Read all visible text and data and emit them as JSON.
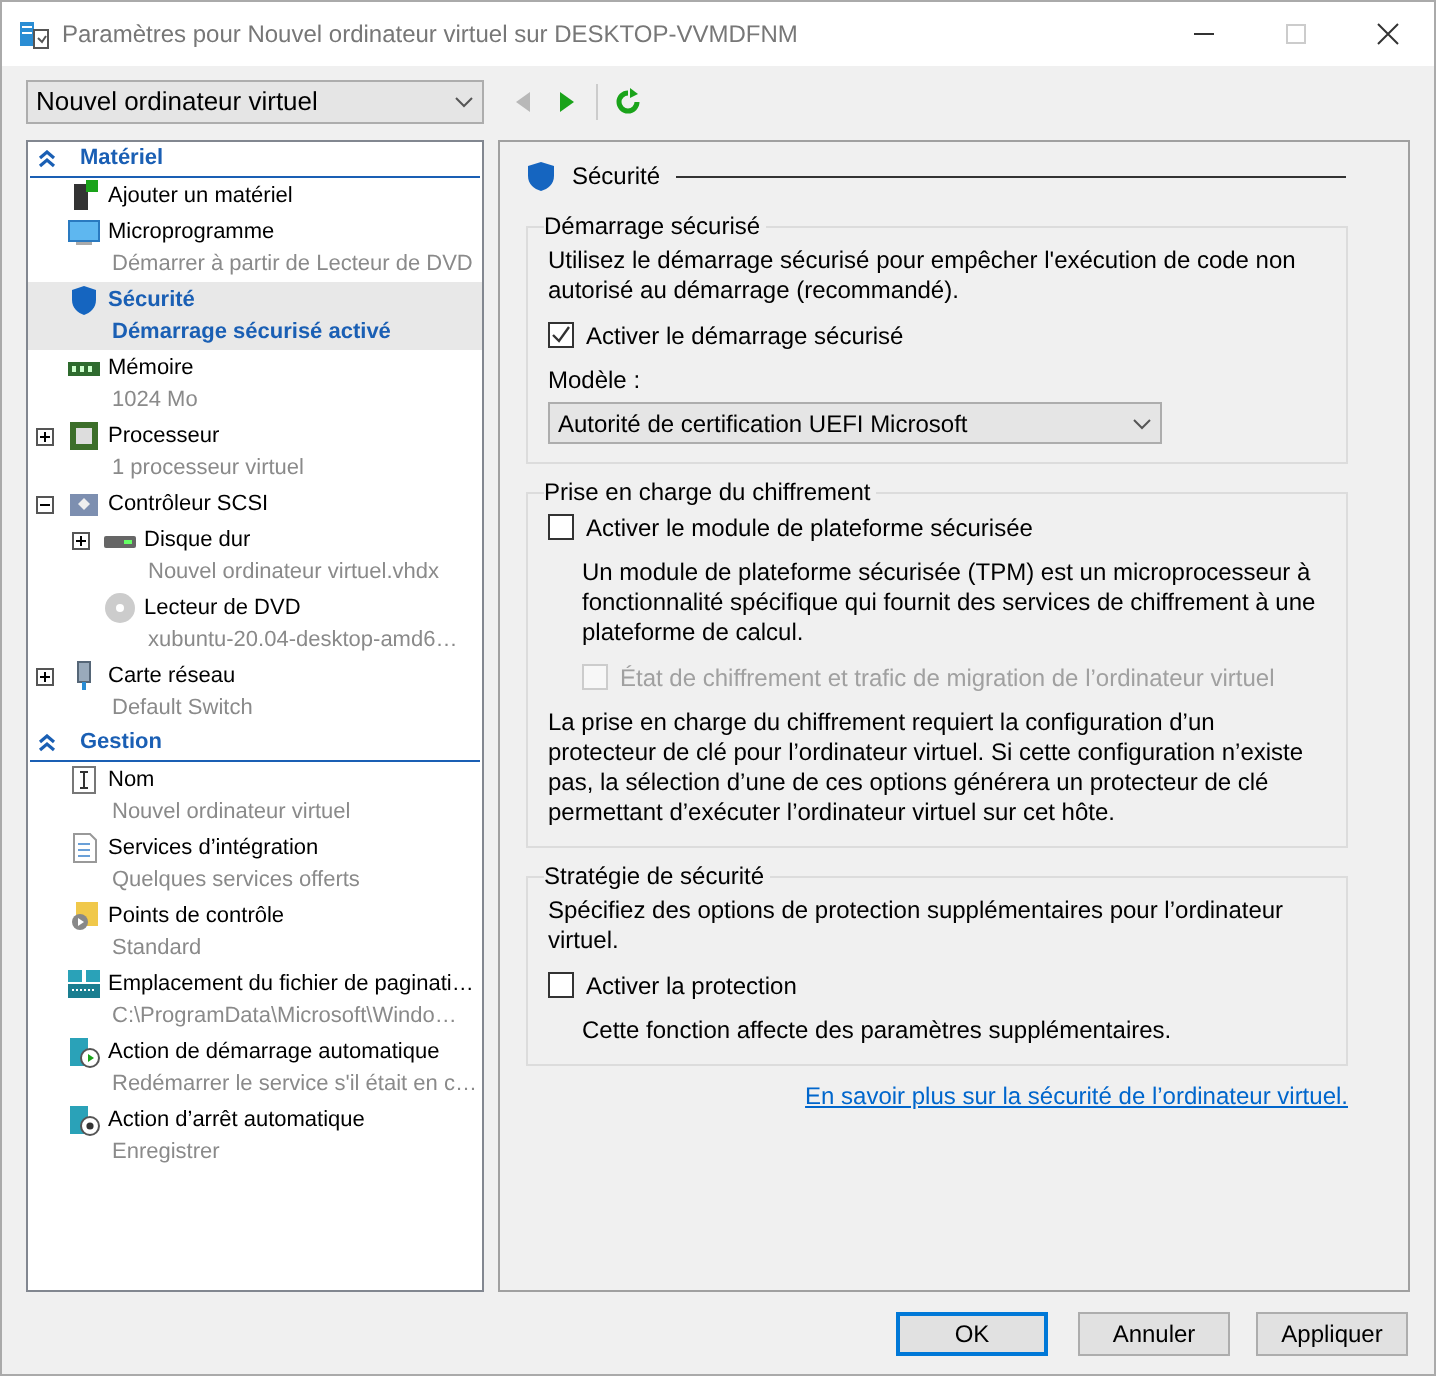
{
  "window": {
    "title": "Paramètres pour Nouvel ordinateur virtuel sur DESKTOP-VVMDFNM"
  },
  "toolbar": {
    "vm_select": "Nouvel ordinateur virtuel",
    "nav_buttons": [
      {
        "kind": "back",
        "disabled": true
      },
      {
        "kind": "forward",
        "disabled": false
      },
      {
        "kind": "refresh",
        "disabled": false
      }
    ]
  },
  "sidebar": {
    "sections": [
      {
        "title": "Matériel",
        "expanded": true,
        "items": [
          {
            "name": "Ajouter un matériel",
            "kind": "add-hardware",
            "selected": false
          },
          {
            "name": "Microprogramme",
            "detail": "Démarrer à partir de Lecteur de DVD",
            "kind": "monitor",
            "selected": false
          },
          {
            "name": "Sécurité",
            "detail": "Démarrage sécurisé activé",
            "kind": "shield",
            "selected": true
          },
          {
            "name": "Mémoire",
            "detail": "1024 Mo",
            "kind": "memory",
            "selected": false
          },
          {
            "name": "Processeur",
            "detail": "1 processeur virtuel",
            "kind": "chip",
            "selected": false,
            "expanded": false
          },
          {
            "name": "Contrôleur SCSI",
            "kind": "controller",
            "selected": false,
            "expanded": true,
            "children": [
              {
                "name": "Disque dur",
                "detail": "Nouvel ordinateur virtuel.vhdx",
                "kind": "disk",
                "selected": false,
                "expanded": false
              },
              {
                "name": "Lecteur de DVD",
                "detail": "xubuntu-20.04-desktop-amd6…",
                "kind": "dvd",
                "selected": false
              }
            ]
          },
          {
            "name": "Carte réseau",
            "detail": "Default Switch",
            "kind": "network",
            "selected": false,
            "expanded": false
          }
        ]
      },
      {
        "title": "Gestion",
        "expanded": true,
        "items": [
          {
            "name": "Nom",
            "detail": "Nouvel ordinateur virtuel",
            "kind": "name",
            "selected": false
          },
          {
            "name": "Services d’intégration",
            "detail": "Quelques services offerts",
            "kind": "checklist",
            "selected": false
          },
          {
            "name": "Points de contrôle",
            "detail": "Standard",
            "kind": "checkpoint",
            "selected": false
          },
          {
            "name": "Emplacement du fichier de paginati…",
            "detail": "C:\\ProgramData\\Microsoft\\Windo…",
            "kind": "paging",
            "selected": false
          },
          {
            "name": "Action de démarrage automatique",
            "detail": "Redémarrer le service s'il était en c…",
            "kind": "autostart",
            "selected": false
          },
          {
            "name": "Action d’arrêt automatique",
            "detail": "Enregistrer",
            "kind": "autostop",
            "selected": false
          }
        ]
      }
    ]
  },
  "panel": {
    "title": "Sécurité",
    "groups": [
      {
        "title": "Démarrage sécurisé",
        "controls": [
          {
            "kind": "text",
            "text": "Utilisez le démarrage sécurisé pour empêcher l'exécution de code non autorisé au démarrage (recommandé)."
          },
          {
            "kind": "checkbox",
            "label": "Activer le démarrage sécurisé",
            "checked": true,
            "disabled": false
          },
          {
            "kind": "label",
            "text": "Modèle :"
          },
          {
            "kind": "select",
            "value": "Autorité de certification UEFI Microsoft"
          }
        ]
      },
      {
        "title": "Prise en charge du chiffrement",
        "controls": [
          {
            "kind": "checkbox",
            "label": "Activer le module de plateforme sécurisée",
            "checked": false,
            "disabled": false
          },
          {
            "kind": "note",
            "text": "Un module de plateforme sécurisée (TPM) est un microprocesseur à fonctionnalité spécifique qui fournit des services de chiffrement à une plateforme de calcul."
          },
          {
            "kind": "subcheckbox",
            "label": "État de chiffrement et trafic de migration de l’ordinateur virtuel",
            "checked": false,
            "disabled": true
          },
          {
            "kind": "text",
            "text": "La prise en charge du chiffrement requiert la configuration d’un protecteur de clé pour l’ordinateur virtuel. Si cette configuration n’existe pas, la sélection d’une de ces options générera un protecteur de clé permettant d’exécuter l’ordinateur virtuel sur cet hôte."
          }
        ]
      },
      {
        "title": "Stratégie de sécurité",
        "controls": [
          {
            "kind": "text",
            "text": "Spécifiez des options de protection supplémentaires pour l’ordinateur virtuel."
          },
          {
            "kind": "checkbox",
            "label": "Activer la protection",
            "checked": false,
            "disabled": false
          },
          {
            "kind": "note",
            "text": "Cette fonction affecte des paramètres supplémentaires."
          }
        ]
      }
    ],
    "link": "En savoir plus sur la sécurité de l’ordinateur virtuel."
  },
  "buttons": [
    {
      "label": "OK",
      "default": true
    },
    {
      "label": "Annuler",
      "default": false
    },
    {
      "label": "Appliquer",
      "default": false
    }
  ]
}
